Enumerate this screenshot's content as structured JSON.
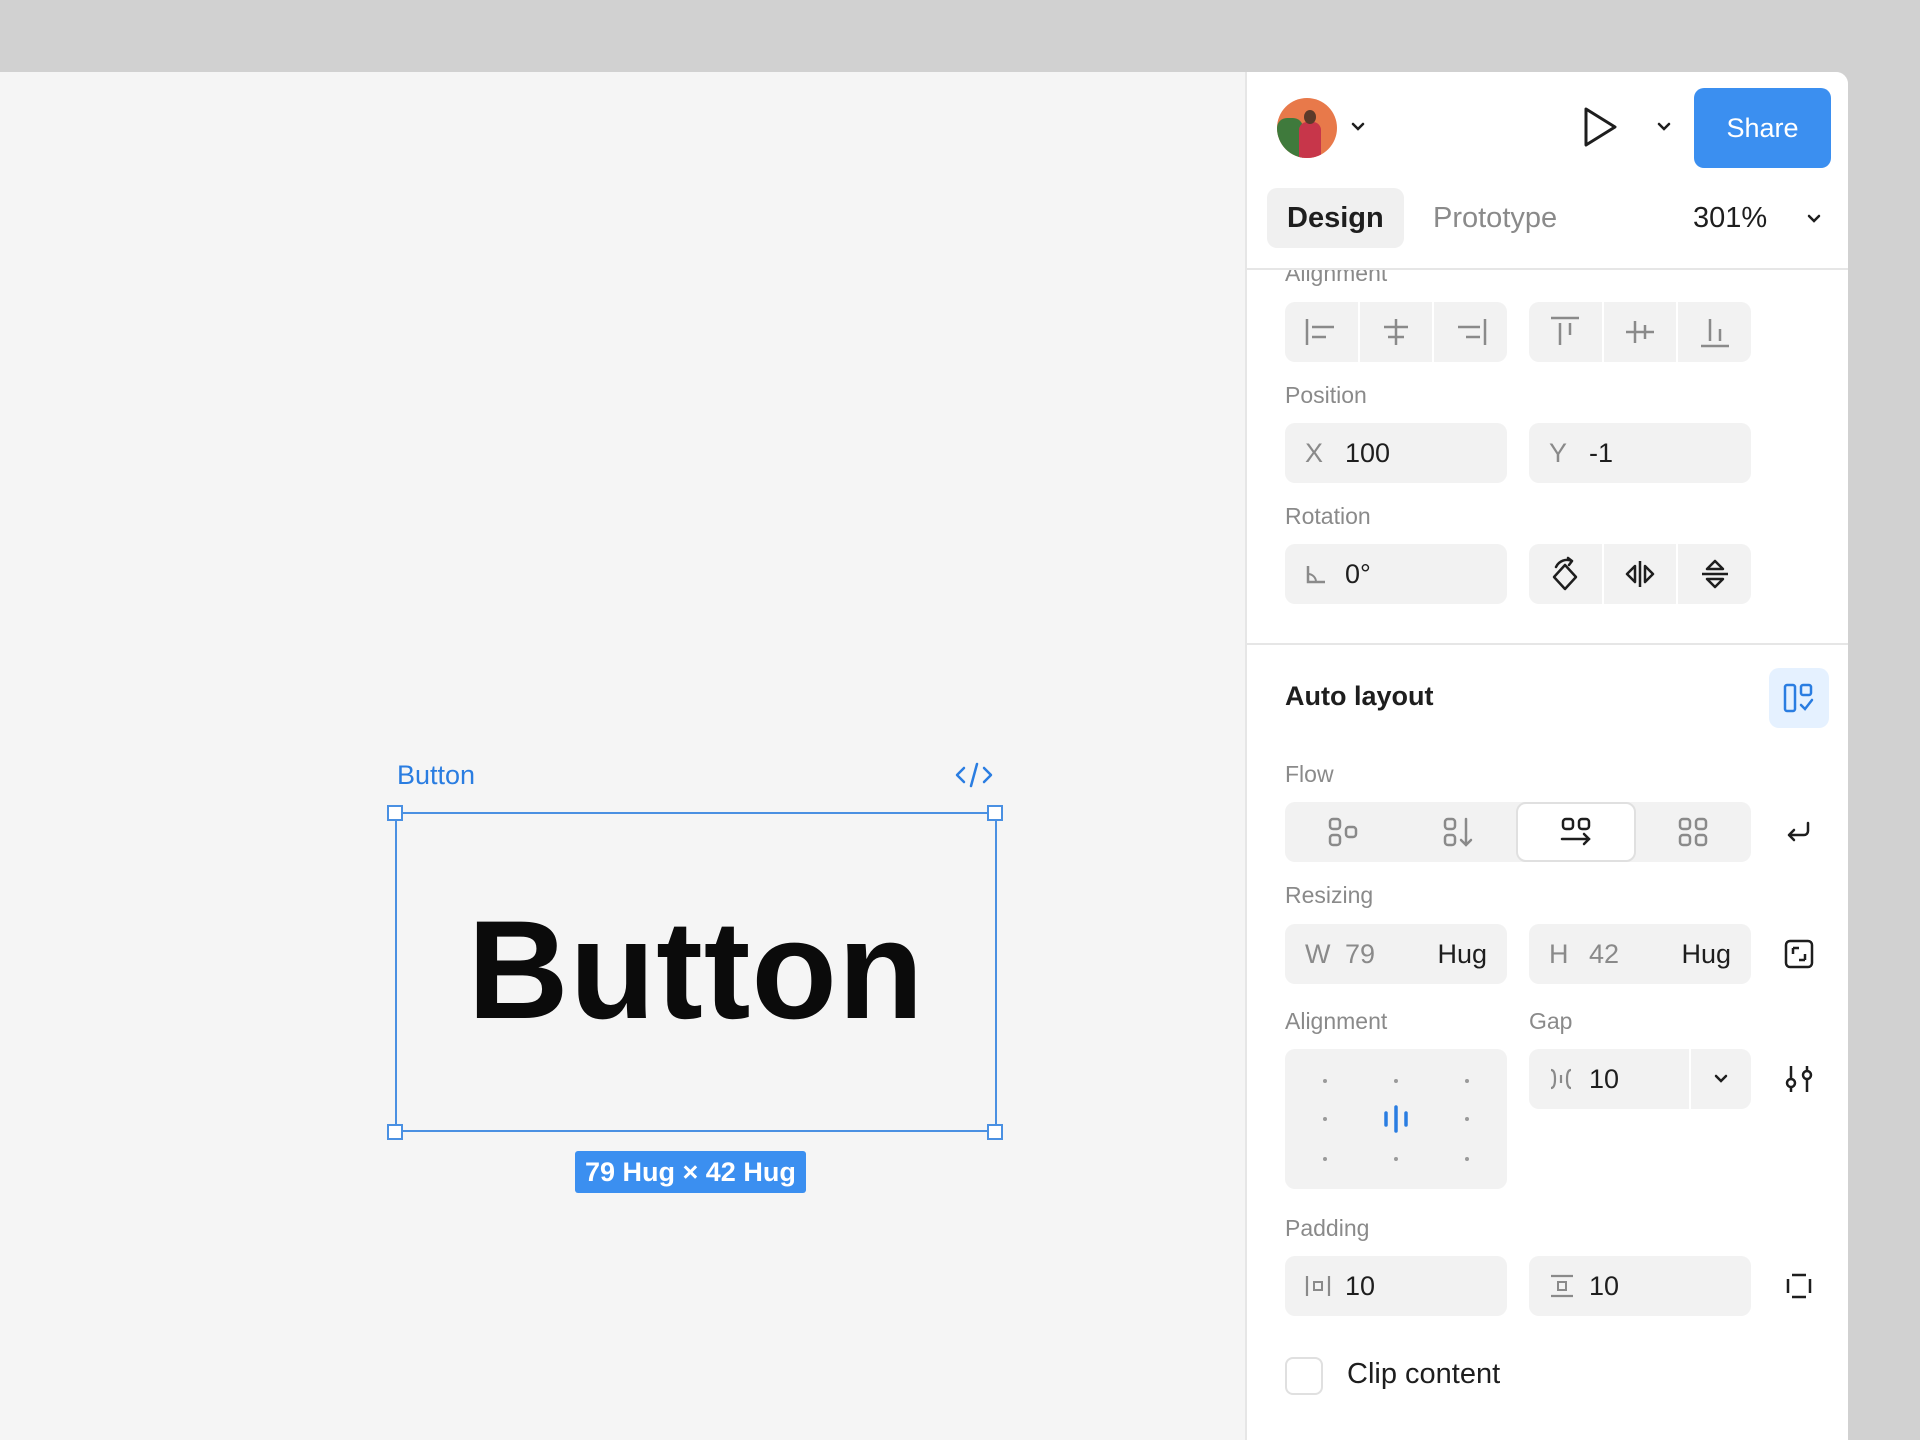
{
  "canvas": {
    "frame_label": "Button",
    "button_text": "Button",
    "dimensions_badge": "79 Hug × 42 Hug"
  },
  "header": {
    "share_label": "Share",
    "tabs": [
      {
        "label": "Design"
      },
      {
        "label": "Prototype"
      }
    ],
    "zoom": "301%"
  },
  "alignment_section": {
    "label": "Alignment"
  },
  "position": {
    "label": "Position",
    "x_prefix": "X",
    "x_value": "100",
    "y_prefix": "Y",
    "y_value": "-1"
  },
  "rotation": {
    "label": "Rotation",
    "value": "0°"
  },
  "auto_layout": {
    "title": "Auto layout",
    "flow_label": "Flow",
    "resizing_label": "Resizing",
    "width": {
      "prefix": "W",
      "value": "79",
      "mode": "Hug"
    },
    "height": {
      "prefix": "H",
      "value": "42",
      "mode": "Hug"
    },
    "alignment_label": "Alignment",
    "gap_label": "Gap",
    "gap_value": "10",
    "padding_label": "Padding",
    "padding_horizontal": "10",
    "padding_vertical": "10",
    "clip_content_label": "Clip content"
  },
  "colors": {
    "accent": "#3b8ff0",
    "selection": "#4a90e2"
  }
}
